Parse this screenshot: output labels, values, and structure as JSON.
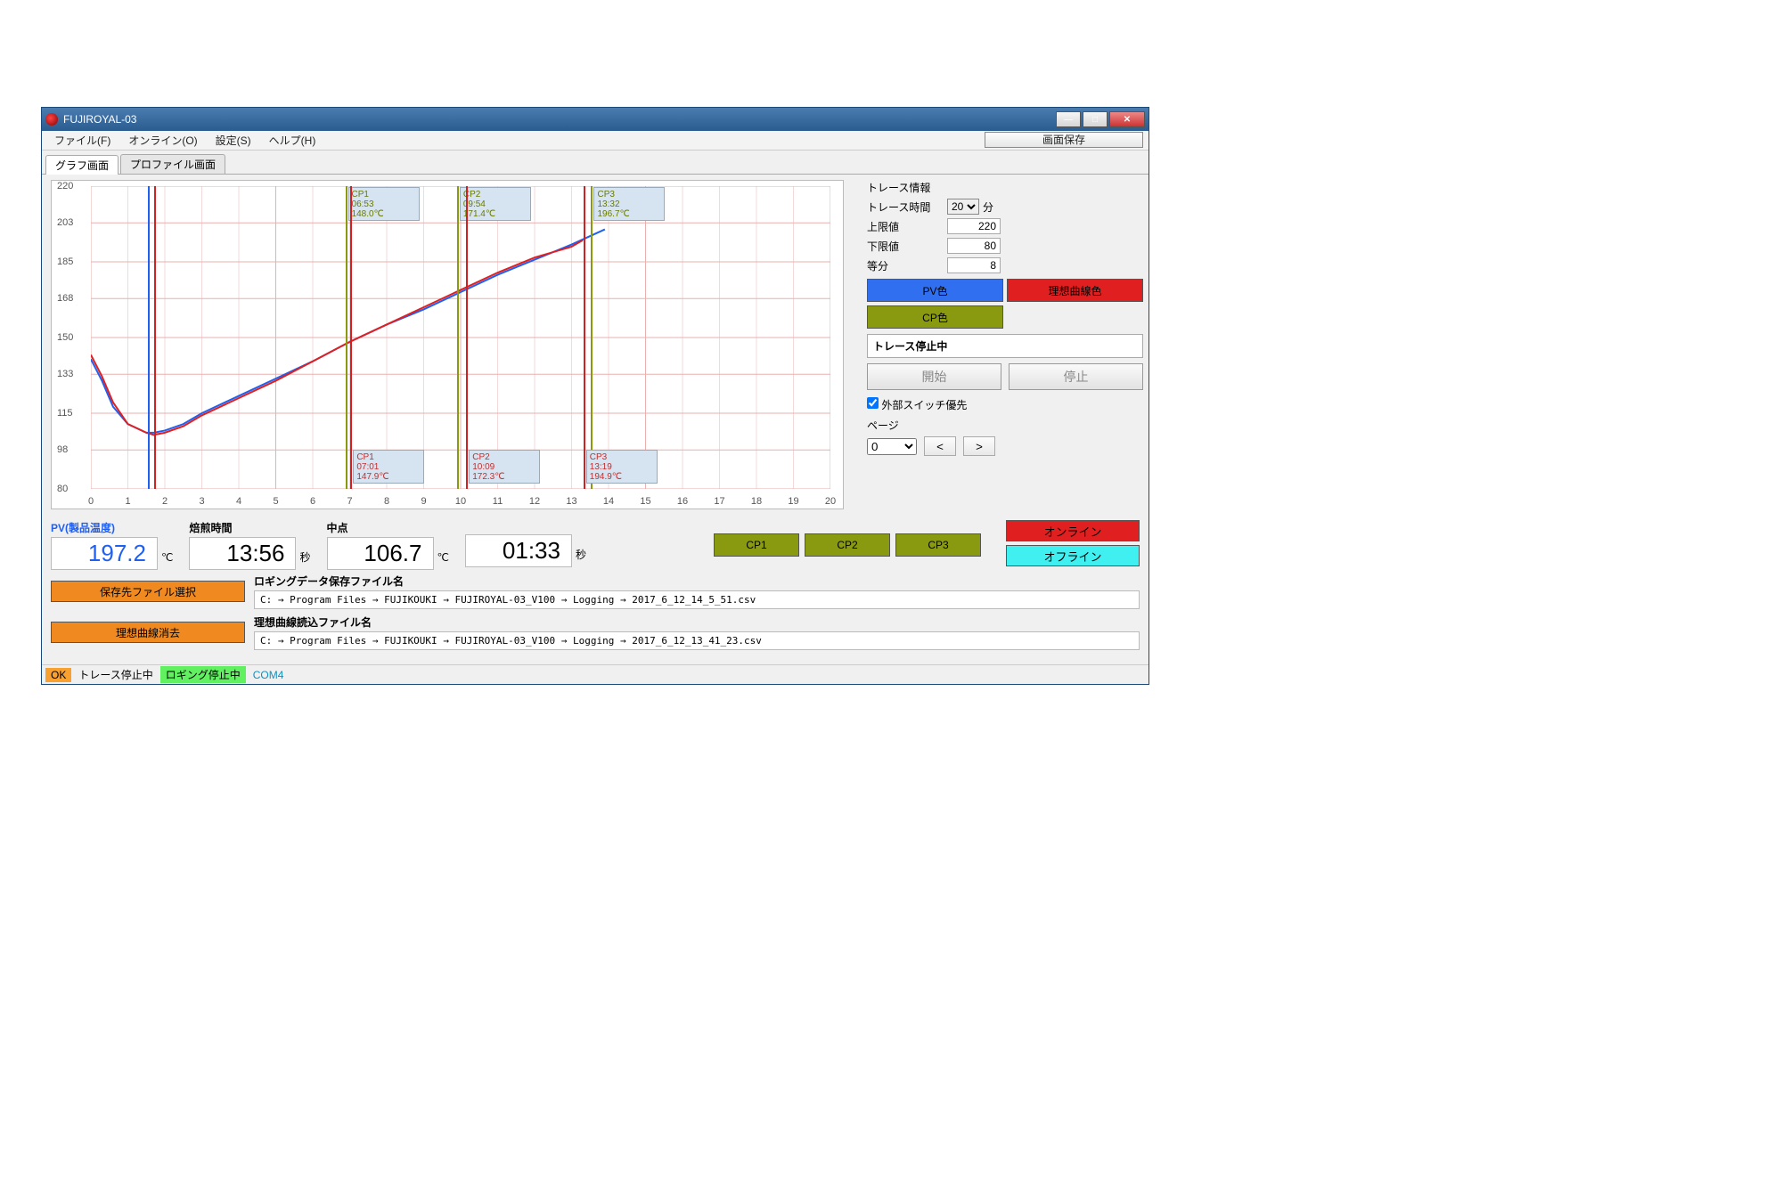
{
  "window": {
    "title": "FUJIROYAL-03"
  },
  "menu": {
    "file": "ファイル(F)",
    "online": "オンライン(O)",
    "settings": "設定(S)",
    "help": "ヘルプ(H)",
    "screen_save": "画面保存"
  },
  "tabs": {
    "graph": "グラフ画面",
    "profile": "プロファイル画面"
  },
  "chart_data": {
    "type": "line",
    "xlabel": "",
    "ylabel": "",
    "xlim": [
      0,
      20
    ],
    "ylim": [
      80,
      220
    ],
    "yticks": [
      80,
      98,
      115,
      133,
      150,
      168,
      185,
      203,
      220
    ],
    "xticks": [
      0,
      1,
      2,
      3,
      4,
      5,
      6,
      7,
      8,
      9,
      10,
      11,
      12,
      13,
      14,
      15,
      16,
      17,
      18,
      19,
      20
    ],
    "series": [
      {
        "name": "PV",
        "color": "#2060f0",
        "x": [
          0,
          0.3,
          0.6,
          1,
          1.5,
          1.7,
          2,
          2.5,
          3,
          4,
          5,
          6,
          7,
          8,
          9,
          10,
          11,
          12,
          13,
          13.9
        ],
        "y": [
          140,
          130,
          118,
          110,
          106,
          106,
          107,
          110,
          115,
          123,
          131,
          139,
          148,
          156,
          163,
          171,
          179,
          186,
          193,
          200
        ]
      },
      {
        "name": "理想曲線",
        "color": "#e02020",
        "x": [
          0,
          0.3,
          0.6,
          1,
          1.5,
          1.7,
          2,
          2.5,
          3,
          4,
          5,
          6,
          7,
          8,
          9,
          10,
          11,
          12,
          13,
          13.3
        ],
        "y": [
          142,
          132,
          120,
          110,
          106,
          105,
          106,
          109,
          114,
          122,
          130,
          139,
          148,
          156,
          164,
          172,
          180,
          187,
          192,
          195
        ]
      }
    ],
    "cp_markers_top": [
      {
        "name": "CP1",
        "x": 6.88,
        "time": "06:53",
        "temp": "148.0℃",
        "color": "olive"
      },
      {
        "name": "CP2",
        "x": 9.9,
        "time": "09:54",
        "temp": "171.4℃",
        "color": "olive"
      },
      {
        "name": "CP3",
        "x": 13.53,
        "time": "13:32",
        "temp": "196.7℃",
        "color": "olive"
      }
    ],
    "cp_markers_bot": [
      {
        "name": "CP1",
        "x": 7.02,
        "time": "07:01",
        "temp": "147.9℃",
        "color": "red"
      },
      {
        "name": "CP2",
        "x": 10.15,
        "time": "10:09",
        "temp": "172.3℃",
        "color": "red"
      },
      {
        "name": "CP3",
        "x": 13.32,
        "time": "13:19",
        "temp": "194.9℃",
        "color": "red"
      }
    ],
    "midpoint_marker": {
      "x_blue": 1.55,
      "x_red": 1.7
    }
  },
  "trace": {
    "heading": "トレース情報",
    "time_label": "トレース時間",
    "time_value": "20",
    "time_unit": "分",
    "upper_label": "上限値",
    "upper_value": "220",
    "lower_label": "下限値",
    "lower_value": "80",
    "div_label": "等分",
    "div_value": "8",
    "pv_color_btn": "PV色",
    "ideal_color_btn": "理想曲線色",
    "cp_color_btn": "CP色",
    "status": "トレース停止中",
    "start_btn": "開始",
    "stop_btn": "停止",
    "ext_switch_label": "外部スイッチ優先",
    "page_label": "ページ",
    "page_value": "0",
    "prev": "<",
    "next": ">"
  },
  "readouts": {
    "pv_label": "PV(製品温度)",
    "pv_value": "197.2",
    "pv_unit": "℃",
    "roast_label": "焙煎時間",
    "roast_value": "13:56",
    "roast_unit": "秒",
    "mid_label": "中点",
    "mid_value": "106.7",
    "mid_unit": "℃",
    "mid_time_value": "01:33",
    "mid_time_unit": "秒",
    "cp1": "CP1",
    "cp2": "CP2",
    "cp3": "CP3",
    "online": "オンライン",
    "offline": "オフライン"
  },
  "files": {
    "save_btn": "保存先ファイル選択",
    "logging_label": "ロギングデータ保存ファイル名",
    "logging_path": "C: → Program Files → FUJIKOUKI → FUJIROYAL-03_V100 → Logging → 2017_6_12_14_5_51.csv",
    "ideal_clear_btn": "理想曲線消去",
    "ideal_label": "理想曲線読込ファイル名",
    "ideal_path": "C: → Program Files → FUJIKOUKI → FUJIROYAL-03_V100 → Logging → 2017_6_12_13_41_23.csv"
  },
  "status": {
    "ok": "OK",
    "trace": "トレース停止中",
    "logging": "ロギング停止中",
    "com": "COM4"
  }
}
